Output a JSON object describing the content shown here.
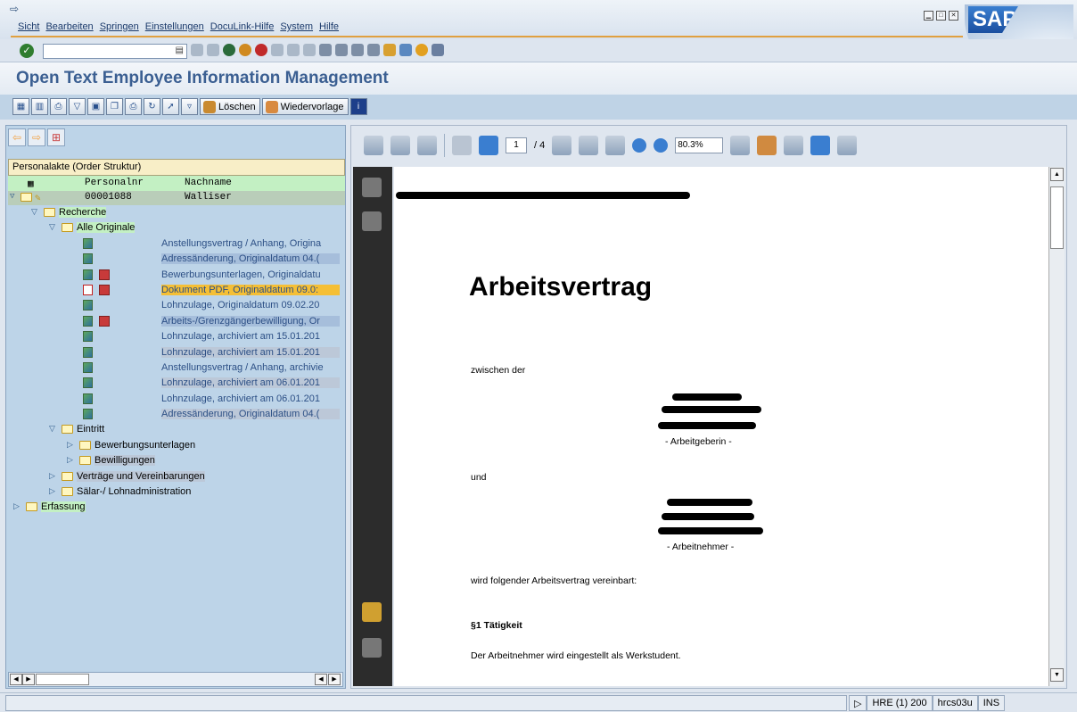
{
  "menu": {
    "items": [
      "Sicht",
      "Bearbeiten",
      "Springen",
      "Einstellungen",
      "DocuLink-Hilfe",
      "System",
      "Hilfe"
    ]
  },
  "window_controls": [
    "minimize-icon",
    "maximize-icon",
    "close-icon"
  ],
  "logo": "SAP",
  "page_title": "Open Text Employee Information Management",
  "app_toolbar": {
    "delete_label": "Löschen",
    "resubmit_label": "Wiedervorlage"
  },
  "tree": {
    "header": "Personalakte (Order Struktur)",
    "columns": [
      "Personalnr",
      "Nachname"
    ],
    "person": {
      "nr": "00001088",
      "name": "Walliser"
    },
    "folders": {
      "recherche": "Recherche",
      "alle_originale": "Alle Originale",
      "eintritt": "Eintritt",
      "bewerbungsunterlagen": "Bewerbungsunterlagen",
      "bewilligungen": "Bewilligungen",
      "vertraege": "Verträge und Vereinbarungen",
      "salaer": "Sälar-/ Lohnadministration",
      "erfassung": "Erfassung"
    },
    "documents": [
      "Anstellungsvertrag / Anhang, Origina",
      "Adressänderung, Originaldatum 04.(",
      "Bewerbungsunterlagen, Originaldatu",
      "Dokument PDF, Originaldatum 09.0:",
      "Lohnzulage, Originaldatum 09.02.20",
      "Arbeits-/Grenzgängerbewilligung, Or",
      "Lohnzulage, archiviert am 15.01.201",
      "Lohnzulage, archiviert am 15.01.201",
      "Anstellungsvertrag / Anhang, archivie",
      "Lohnzulage, archiviert am 06.01.201",
      "Lohnzulage, archiviert am 06.01.201",
      "Adressänderung, Originaldatum 04.("
    ]
  },
  "viewer": {
    "page_current": "1",
    "page_total": "/ 4",
    "zoom": "80.3%"
  },
  "document": {
    "heading": "Arbeitsvertrag",
    "between": "zwischen der",
    "employer": "- Arbeitgeberin -",
    "and": "und",
    "employee": "- Arbeitnehmer -",
    "agreed": "wird folgender Arbeitsvertrag vereinbart:",
    "section1": "§1 Tätigkeit",
    "section1_text": "Der Arbeitnehmer wird eingestellt als Werkstudent."
  },
  "status": {
    "system": "HRE (1) 200",
    "server": "hrcs03u",
    "mode": "INS"
  }
}
